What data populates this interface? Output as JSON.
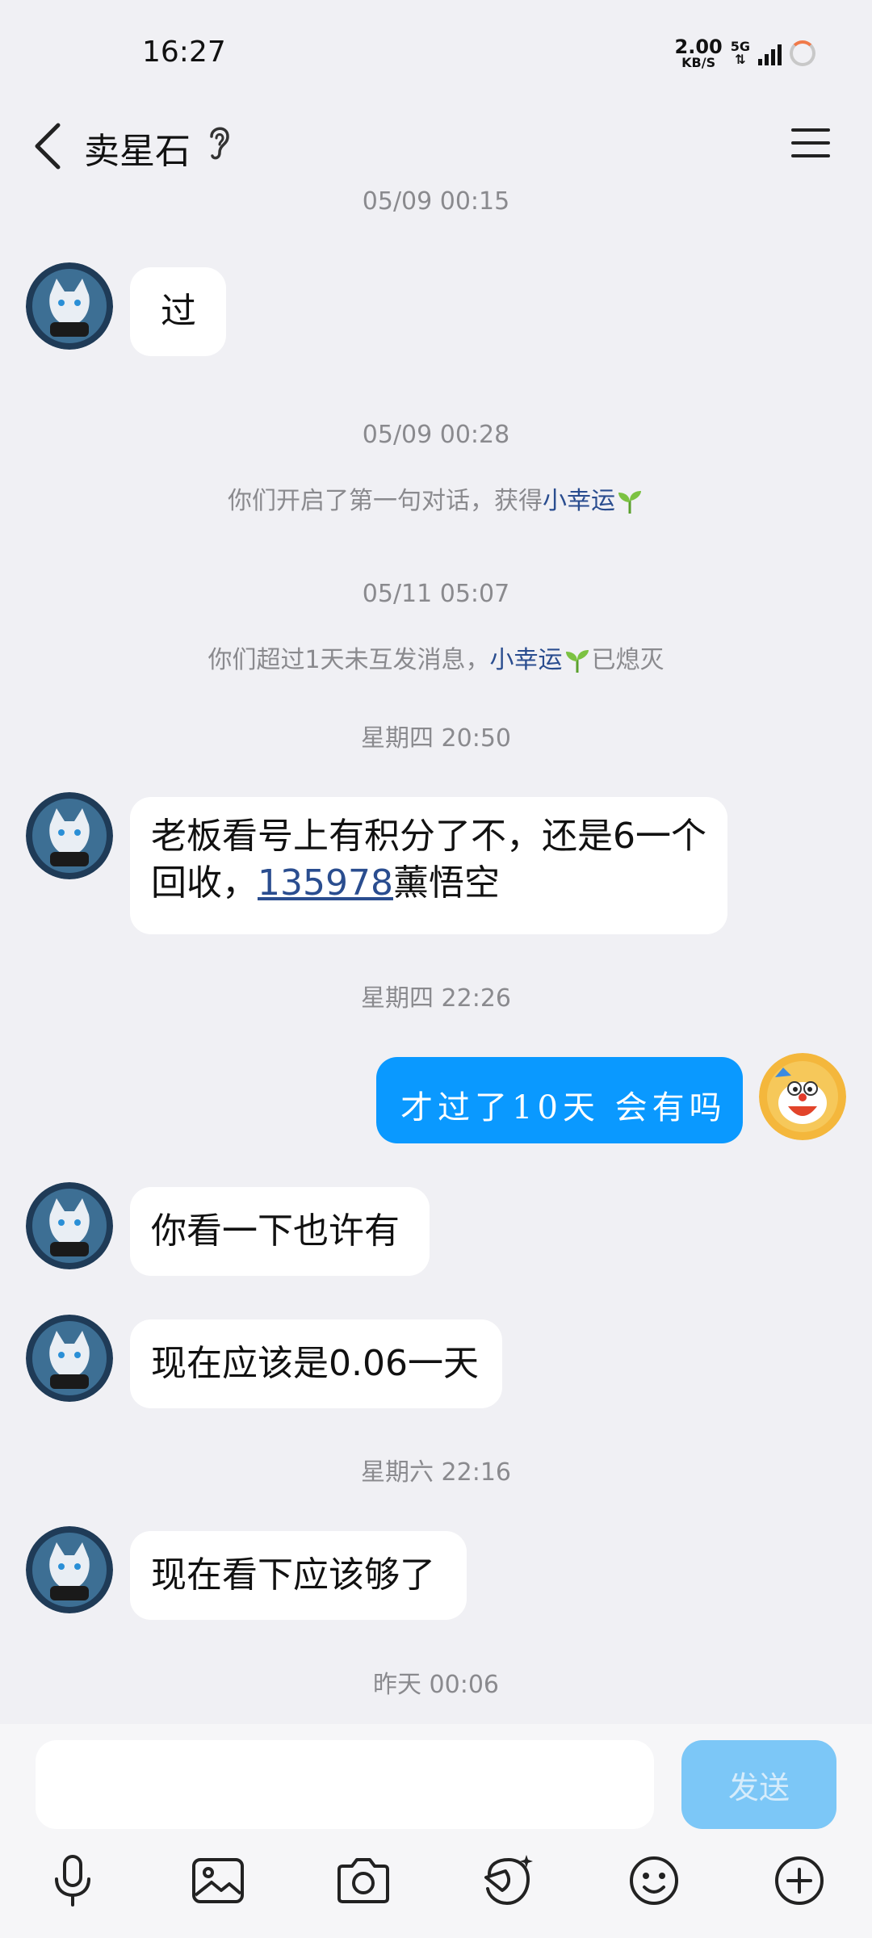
{
  "status_bar": {
    "time": "16:27",
    "net_speed_value": "2.00",
    "net_speed_unit": "KB/S",
    "network_type": "5G"
  },
  "header": {
    "title": "卖星石"
  },
  "messages": {
    "ts1": "05/09 00:15",
    "msg1": "过",
    "ts2": "05/09 00:28",
    "sys1_prefix": "你们开启了第一句对话，获得",
    "sys1_highlight": "小幸运",
    "ts3": "05/11 05:07",
    "sys2_prefix": "你们超过1天未互发消息，",
    "sys2_highlight": "小幸运",
    "sys2_suffix": "已熄灭",
    "ts4": "星期四 20:50",
    "msg2_part1": "老板看号上有积分了不，还是6一个回收，",
    "msg2_link": "135978",
    "msg2_part2": "薰悟空",
    "ts5": "星期四 22:26",
    "msg_me": "才过了10天  会有吗",
    "msg3": "你看一下也许有",
    "msg4": "现在应该是0.06一天",
    "ts6": "星期六 22:16",
    "msg5": "现在看下应该够了",
    "ts7": "昨天 00:06"
  },
  "input": {
    "send_label": "发送"
  },
  "colors": {
    "my_bubble": "#0a99ff",
    "highlight": "#2a4d8f",
    "send_button": "#7cc7f7"
  },
  "icons": [
    "microphone-icon",
    "image-icon",
    "camera-icon",
    "sticker-icon",
    "emoji-icon",
    "plus-icon"
  ]
}
